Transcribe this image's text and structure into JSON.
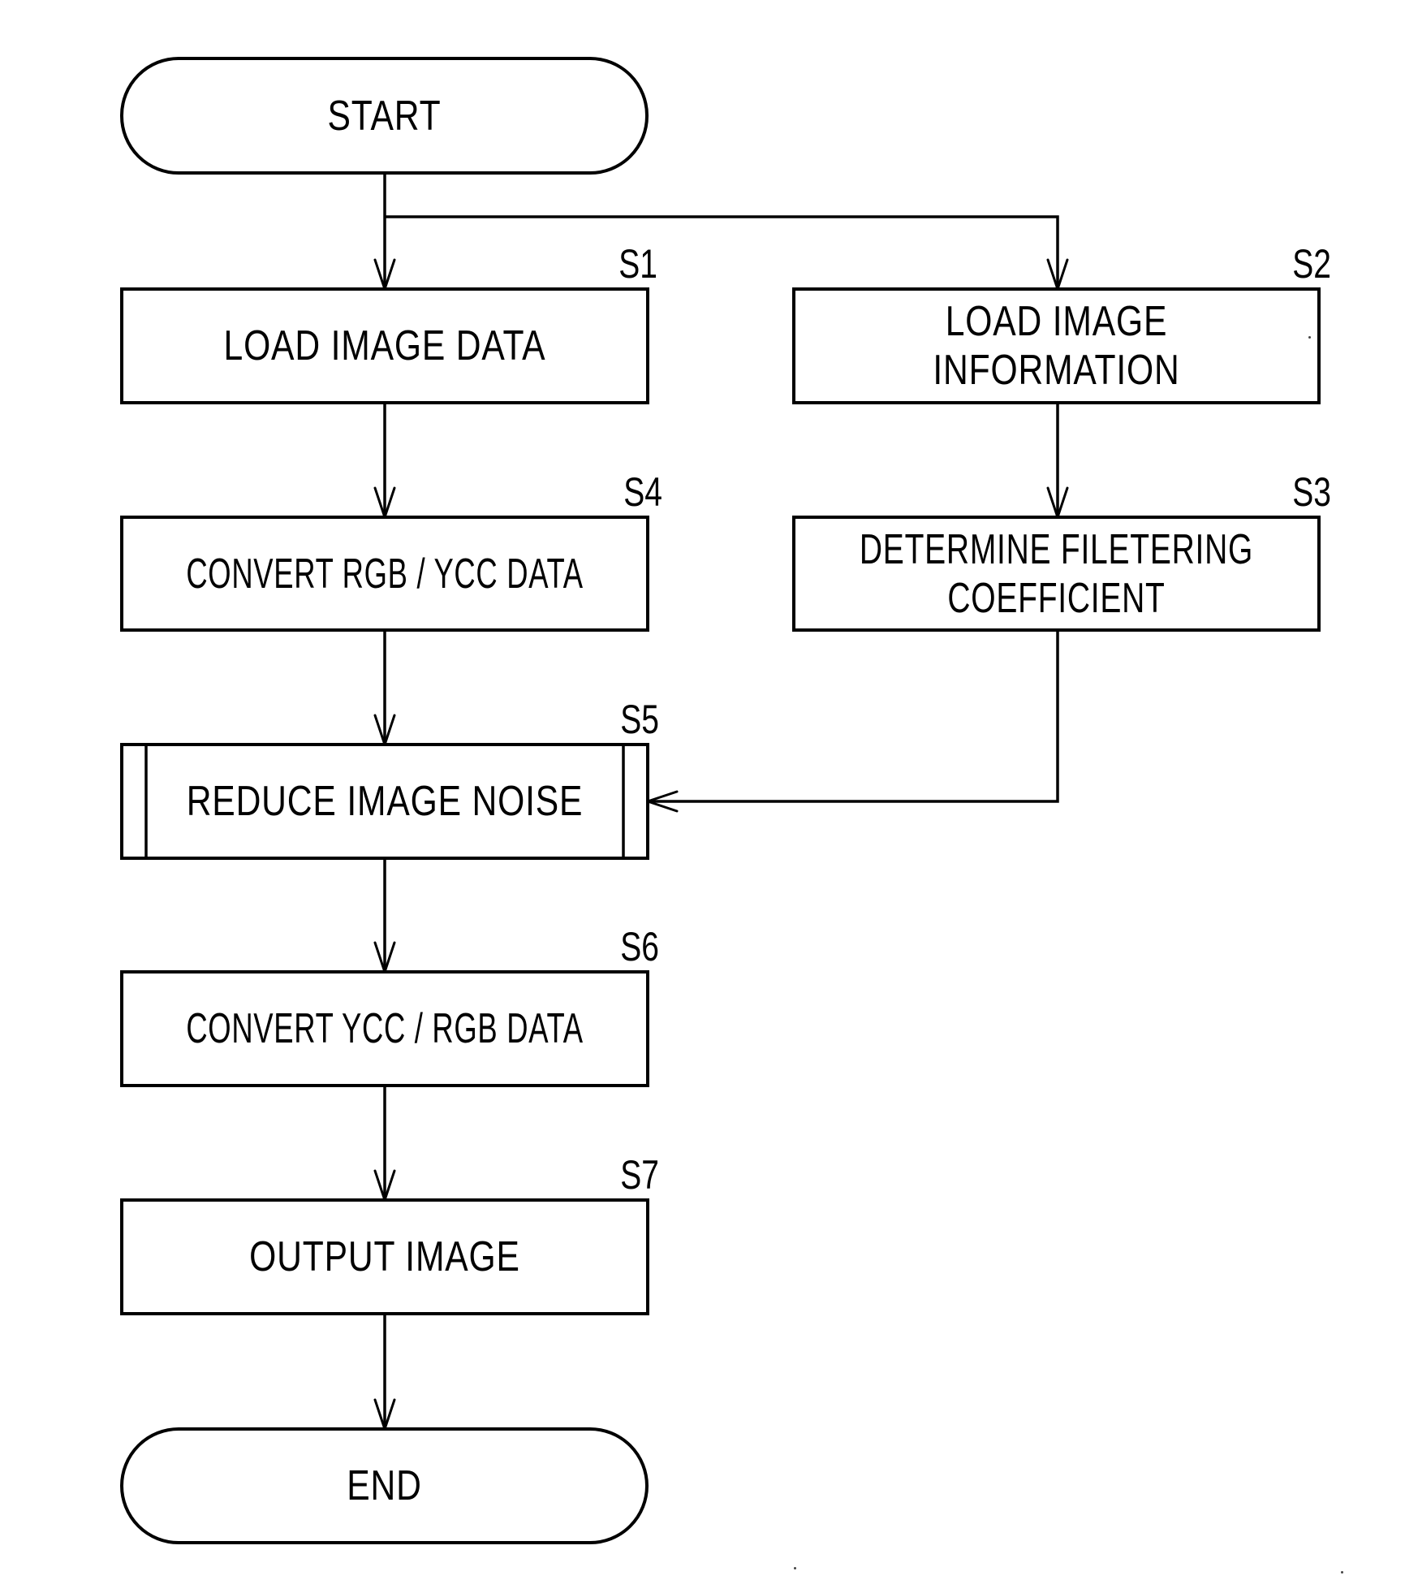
{
  "diagram": {
    "type": "flowchart",
    "terminals": {
      "start": "START",
      "end": "END"
    },
    "steps": [
      {
        "id": "S1",
        "label": "S1",
        "lines": [
          "LOAD IMAGE DATA"
        ],
        "kind": "process"
      },
      {
        "id": "S2",
        "label": "S2",
        "lines": [
          "LOAD IMAGE",
          "INFORMATION"
        ],
        "kind": "process"
      },
      {
        "id": "S3",
        "label": "S3",
        "lines": [
          "DETERMINE FILETERING",
          "COEFFICIENT"
        ],
        "kind": "process"
      },
      {
        "id": "S4",
        "label": "S4",
        "lines": [
          "CONVERT RGB / YCC DATA"
        ],
        "kind": "process"
      },
      {
        "id": "S5",
        "label": "S5",
        "lines": [
          "REDUCE IMAGE NOISE"
        ],
        "kind": "predefined-process"
      },
      {
        "id": "S6",
        "label": "S6",
        "lines": [
          "CONVERT YCC / RGB DATA"
        ],
        "kind": "process"
      },
      {
        "id": "S7",
        "label": "S7",
        "lines": [
          "OUTPUT IMAGE"
        ],
        "kind": "process"
      }
    ],
    "edges": [
      {
        "from": "START",
        "to": "S1"
      },
      {
        "from": "START",
        "to": "S2"
      },
      {
        "from": "S1",
        "to": "S4"
      },
      {
        "from": "S2",
        "to": "S3"
      },
      {
        "from": "S4",
        "to": "S5"
      },
      {
        "from": "S3",
        "to": "S5"
      },
      {
        "from": "S5",
        "to": "S6"
      },
      {
        "from": "S6",
        "to": "S7"
      },
      {
        "from": "S7",
        "to": "END"
      }
    ]
  },
  "text": {
    "start": "START",
    "end": "END",
    "s1": "LOAD IMAGE DATA",
    "s2_line1": "LOAD IMAGE",
    "s2_line2": "INFORMATION",
    "s3_line1": "DETERMINE FILETERING",
    "s3_line2": "COEFFICIENT",
    "s4": "CONVERT RGB / YCC DATA",
    "s5": "REDUCE IMAGE NOISE",
    "s6": "CONVERT YCC / RGB DATA",
    "s7": "OUTPUT IMAGE",
    "tag_s1": "S1",
    "tag_s2": "S2",
    "tag_s3": "S3",
    "tag_s4": "S4",
    "tag_s5": "S5",
    "tag_s6": "S6",
    "tag_s7": "S7"
  }
}
